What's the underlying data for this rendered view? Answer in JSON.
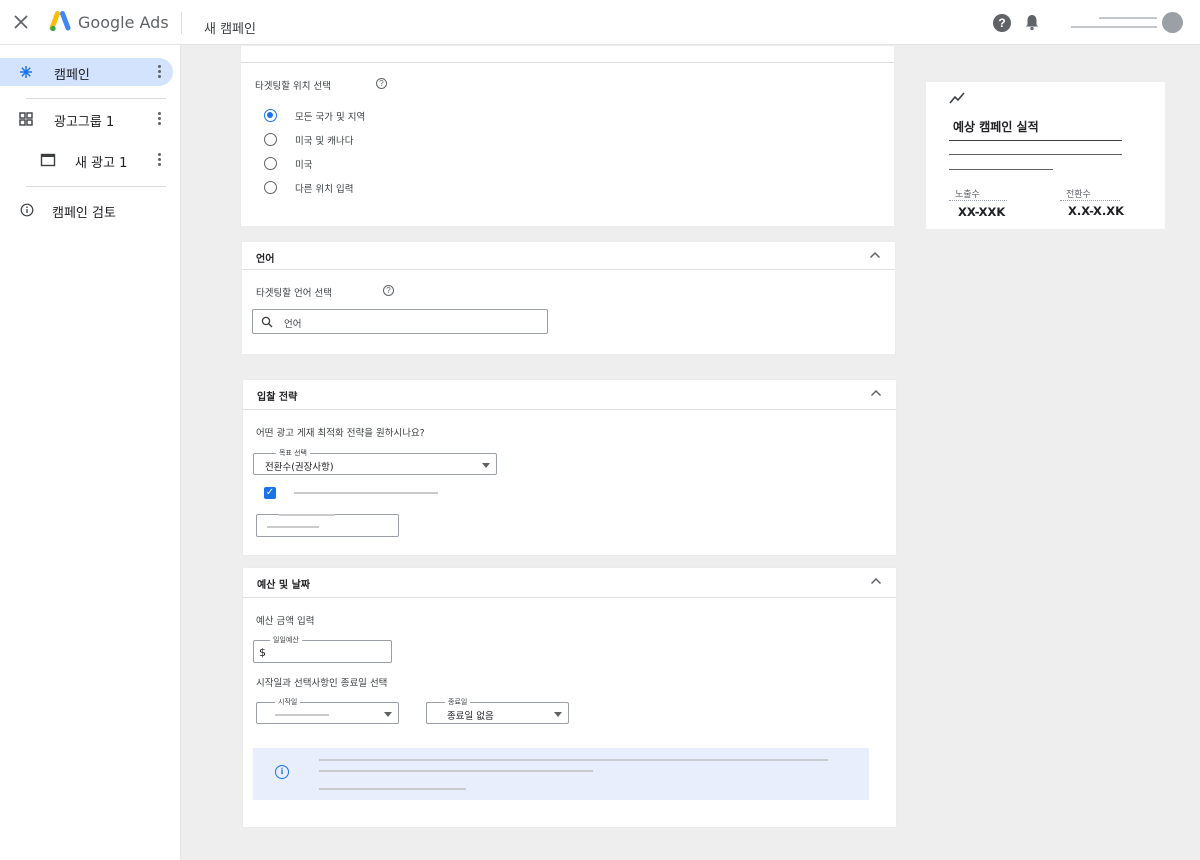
{
  "header": {
    "brand": "Google Ads",
    "page_title": "새 캠페인"
  },
  "sidebar": {
    "items": [
      {
        "label": "캠페인",
        "icon": "campaign-sparkle-icon",
        "active": true
      },
      {
        "label": "광고그룹 1",
        "icon": "grid-icon"
      },
      {
        "label": "새 광고 1",
        "icon": "browser-window-icon"
      },
      {
        "label": "캠페인 검토",
        "icon": "info-icon"
      }
    ]
  },
  "location": {
    "prompt": "타겟팅할 위치 선택",
    "options": [
      "모든 국가 및 지역",
      "미국 및 캐나다",
      "미국",
      "다른 위치 입력"
    ],
    "selected_index": 0
  },
  "language": {
    "title": "언어",
    "prompt": "타겟팅할 언어 선택",
    "search_placeholder": "언어"
  },
  "bidding": {
    "title": "입찰 전략",
    "question": "어떤 광고 게재 최적화 전략을 원하시나요?",
    "goal_legend": "목표 선택",
    "goal_value": "전환수(권장사항)"
  },
  "budget": {
    "title": "예산 및 날짜",
    "amount_prompt": "예산 금액 입력",
    "daily_legend": "일일예산",
    "currency_symbol": "$",
    "dates_prompt": "시작일과 선택사항인 종료일 선택",
    "start_legend": "시작일",
    "end_legend": "종료일",
    "end_value": "종료일 없음"
  },
  "performance": {
    "title": "예상 캠페인 실적",
    "impressions_label": "노출수",
    "impressions_value": "XX-XXK",
    "conversions_label": "전환수",
    "conversions_value": "X.X-X.XK"
  },
  "colors": {
    "accent": "#1a73e8",
    "active_nav": "#d3e3fd",
    "info_bg": "#e8eefb"
  }
}
